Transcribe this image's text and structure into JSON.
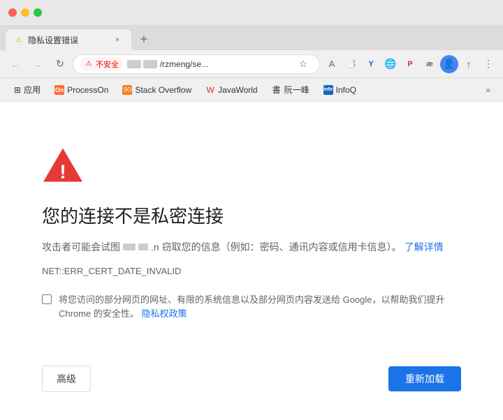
{
  "window": {
    "controls": {
      "close_label": "×",
      "min_label": "−",
      "max_label": "+"
    }
  },
  "tab": {
    "title": "隐私设置错误",
    "favicon_symbol": "⚠",
    "close_symbol": "×"
  },
  "tab_new": {
    "symbol": "+"
  },
  "nav": {
    "back_symbol": "←",
    "forward_symbol": "→",
    "refresh_symbol": "↻",
    "security_label": "不安全",
    "url_visible": "/rzmeng/se...",
    "star_symbol": "☆",
    "more_symbol": "⋮",
    "extensions_symbol": "⚙"
  },
  "bookmarks": {
    "apps_label": "应用",
    "items": [
      {
        "label": "ProcessOn",
        "color": "#ff6b35"
      },
      {
        "label": "Stack Overflow",
        "color": "#f48024"
      },
      {
        "label": "JavaWorld",
        "color": "#d32f2f"
      },
      {
        "label": "阮一峰",
        "color": "#4caf50"
      },
      {
        "label": "InfoQ",
        "color": "#1565c0"
      }
    ],
    "more_symbol": "»"
  },
  "error": {
    "title": "您的连接不是私密连接",
    "description_prefix": "攻击者可能会试图",
    "description_suffix": ".n 窃取您的信息（例如：密码、通讯内容或信用卡信息）。",
    "learn_more": "了解详情",
    "error_code": "NET::ERR_CERT_DATE_INVALID",
    "checkbox_text": "将您访问的部分网页的网址、有限的系统信息以及部分网页内容发送给 Google，以帮助我们提升 Chrome 的安全性。",
    "privacy_link": "隐私权政策",
    "btn_advanced": "高级",
    "btn_reload": "重新加载",
    "triangle_color": "#e53935",
    "exclaim_color": "#ffffff"
  }
}
